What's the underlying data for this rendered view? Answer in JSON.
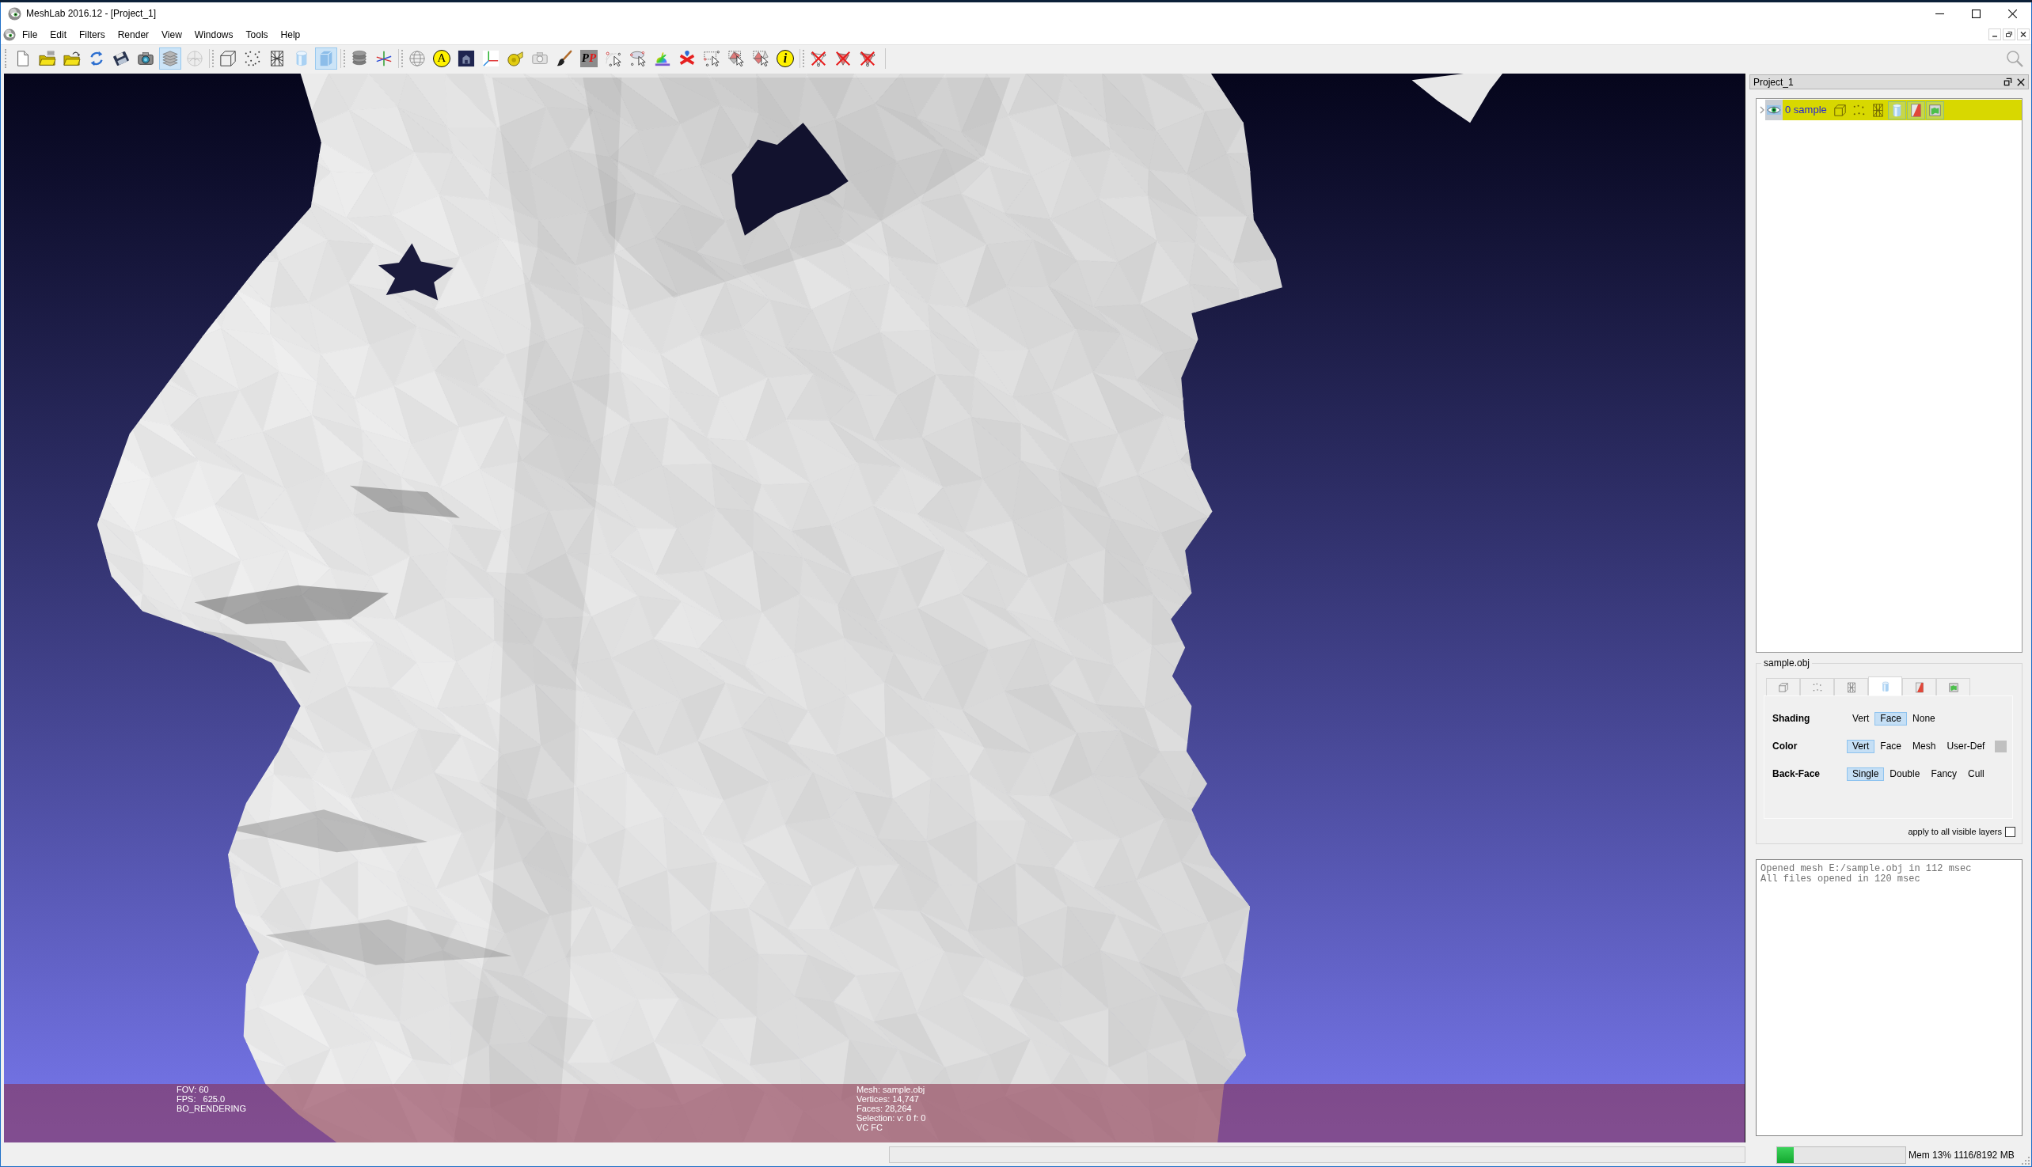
{
  "window": {
    "title": "MeshLab 2016.12 - [Project_1]"
  },
  "menu": [
    "File",
    "Edit",
    "Filters",
    "Render",
    "View",
    "Windows",
    "Tools",
    "Help"
  ],
  "toolbar": [
    [
      {
        "kind": "new-file",
        "selected": false
      },
      {
        "kind": "open-project",
        "selected": false
      },
      {
        "kind": "import-mesh",
        "selected": false
      },
      {
        "kind": "reload",
        "selected": false
      },
      {
        "kind": "save",
        "selected": false
      },
      {
        "kind": "snapshot",
        "selected": false
      },
      {
        "kind": "layers",
        "selected": true
      },
      {
        "kind": "texture",
        "selected": false
      }
    ],
    [
      {
        "kind": "bbox",
        "selected": false
      },
      {
        "kind": "points",
        "selected": false
      },
      {
        "kind": "wireframe",
        "selected": false
      },
      {
        "kind": "smooth",
        "selected": false
      },
      {
        "kind": "flat",
        "selected": true
      }
    ],
    [
      {
        "kind": "layer-stack",
        "selected": false
      },
      {
        "kind": "axes",
        "selected": false
      }
    ],
    [
      {
        "kind": "sphere-grid",
        "selected": false
      },
      {
        "kind": "letter-a",
        "glyph": "A",
        "selected": false
      },
      {
        "kind": "dark-image",
        "selected": false
      },
      {
        "kind": "axes-corner",
        "selected": false
      },
      {
        "kind": "tape",
        "selected": false
      },
      {
        "kind": "raster-camera",
        "selected": false
      },
      {
        "kind": "brush",
        "selected": false
      },
      {
        "kind": "pp",
        "glyph": "PP",
        "selected": false
      },
      {
        "kind": "select-vertices",
        "selected": false
      },
      {
        "kind": "select-ellipse",
        "selected": false
      },
      {
        "kind": "bunny",
        "selected": false
      },
      {
        "kind": "georef",
        "selected": false
      },
      {
        "kind": "select-rect",
        "selected": false
      },
      {
        "kind": "select-faces",
        "selected": false
      },
      {
        "kind": "select-connected",
        "selected": false
      },
      {
        "kind": "info",
        "glyph": "i",
        "selected": false
      }
    ],
    [
      {
        "kind": "delete-vertices",
        "selected": false
      },
      {
        "kind": "delete-faces",
        "selected": false
      },
      {
        "kind": "delete-both",
        "selected": false
      }
    ]
  ],
  "viewport": {
    "info_left": [
      "FOV: 60",
      "FPS:   625.0",
      "BO_RENDERING"
    ],
    "info_right": [
      "Mesh: sample.obj",
      "Vertices: 14,747",
      "Faces: 28,264",
      "Selection: v: 0 f: 0",
      "VC FC"
    ]
  },
  "layers_panel": {
    "title": "Project_1",
    "layers": [
      {
        "name": "0 sample",
        "visible": true,
        "selected": true,
        "modes": [
          {
            "kind": "bbox",
            "on": false
          },
          {
            "kind": "points",
            "on": false
          },
          {
            "kind": "wireframe",
            "on": false
          },
          {
            "kind": "smooth",
            "on": true
          },
          {
            "kind": "flat",
            "on": true
          },
          {
            "kind": "texture",
            "on": true
          }
        ]
      }
    ]
  },
  "render_settings": {
    "title": "sample.obj",
    "tabs": [
      {
        "kind": "bbox",
        "selected": false
      },
      {
        "kind": "points",
        "selected": false
      },
      {
        "kind": "wireframe",
        "selected": false
      },
      {
        "kind": "smooth",
        "selected": true
      },
      {
        "kind": "flat",
        "selected": false
      },
      {
        "kind": "texture",
        "selected": false
      }
    ],
    "rows": [
      {
        "label": "Shading",
        "swatch": false,
        "options": [
          {
            "label": "Vert",
            "selected": false
          },
          {
            "label": "Face",
            "selected": true
          },
          {
            "label": "None",
            "selected": false
          }
        ]
      },
      {
        "label": "Color",
        "swatch": true,
        "options": [
          {
            "label": "Vert",
            "selected": true
          },
          {
            "label": "Face",
            "selected": false
          },
          {
            "label": "Mesh",
            "selected": false
          },
          {
            "label": "User-Def",
            "selected": false
          }
        ]
      },
      {
        "label": "Back-Face",
        "swatch": false,
        "options": [
          {
            "label": "Single",
            "selected": true
          },
          {
            "label": "Double",
            "selected": false
          },
          {
            "label": "Fancy",
            "selected": false
          },
          {
            "label": "Cull",
            "selected": false
          }
        ]
      }
    ],
    "apply_all": {
      "label": "apply to all visible layers",
      "checked": false
    }
  },
  "log": [
    "Opened mesh E:/sample.obj in 112 msec",
    "All files opened in 120 msec"
  ],
  "status_bar": {
    "memory": {
      "level": 0.13,
      "text": "Mem 13% 1116/8192 MB"
    }
  }
}
